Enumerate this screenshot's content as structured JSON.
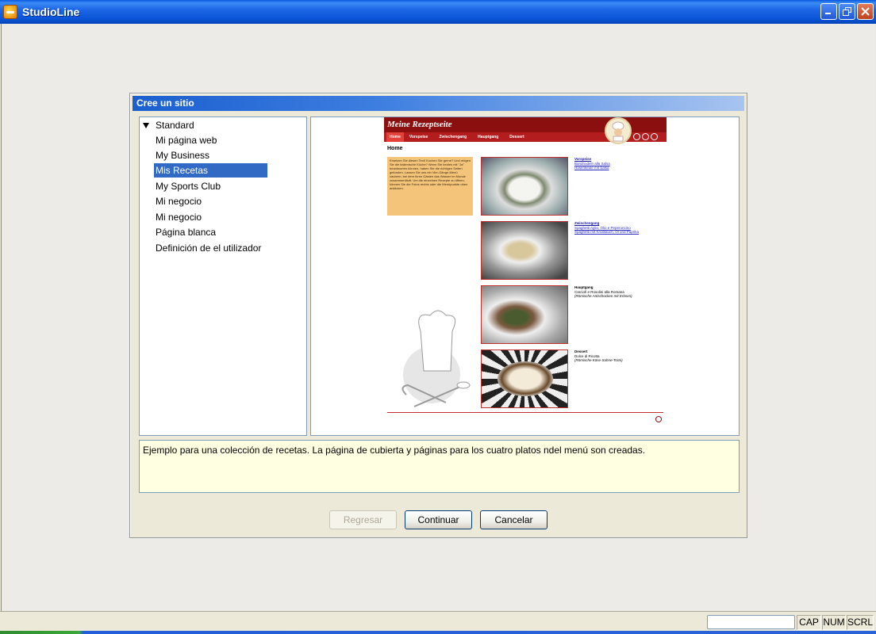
{
  "window": {
    "title": "StudioLine"
  },
  "dialog": {
    "title": "Cree un sitio",
    "tree": {
      "root": "Standard",
      "items": [
        "Mi página web",
        "My Business",
        "Mis Recetas",
        "My Sports Club",
        "Mi negocio",
        "Mi negocio",
        "Página blanca",
        "Definición de el utilizador"
      ],
      "selected_index": 2
    },
    "preview": {
      "site_title": "Meine Rezeptseite",
      "nav": [
        "Home",
        "Vorspeise",
        "Zwischengang",
        "Hauptgang",
        "Dessert"
      ],
      "page_heading": "Home",
      "intro_text": "Ersetzen Sie diesen Text! Kochen Sie gerne? Und mögen Sie die italienische Küche? Wenn Sie beides mit \"Ja\" beantworten können, haben Sie die richtigen Seiten gefunden. Lassen Sie uns ein Vier-Gänge-Menü zaubern, bei dem Ihren Gästen das Wasser im Munde zusammenläuft. Um die einzelnen Rezepte zu öffnen, können Sie die Fotos rechts oder die Menüpunkte oben anklicken.",
      "courses": [
        {
          "name": "Vorspeise",
          "lines": [
            "Bandnudeln alla Salsa",
            "Hasenkeule mit Salsa"
          ]
        },
        {
          "name": "Zwischengang",
          "lines": [
            "Spaghetti Aglio, Olio e Peperoncino",
            "Spaghetti mit Knoblauch, Öl und Paprika"
          ]
        },
        {
          "name": "Hauptgang",
          "lines": [
            "Carciofi e Rosolini alla Romana",
            "(Römische Artischocken mit Erbsen)"
          ]
        },
        {
          "name": "Dessert",
          "lines": [
            "Dolce di Ricotta",
            "(Römische Käse-Sahne-Torte)"
          ]
        }
      ]
    },
    "description": "Ejemplo para una colección de recetas. La página de cubierta y páginas para los cuatro platos  ndel menú son creadas.",
    "buttons": {
      "back": "Regresar",
      "continue": "Continuar",
      "cancel": "Cancelar"
    }
  },
  "statusbar": {
    "field_value": "",
    "cap": "CAP",
    "num": "NUM",
    "scrl": "SCRL"
  }
}
